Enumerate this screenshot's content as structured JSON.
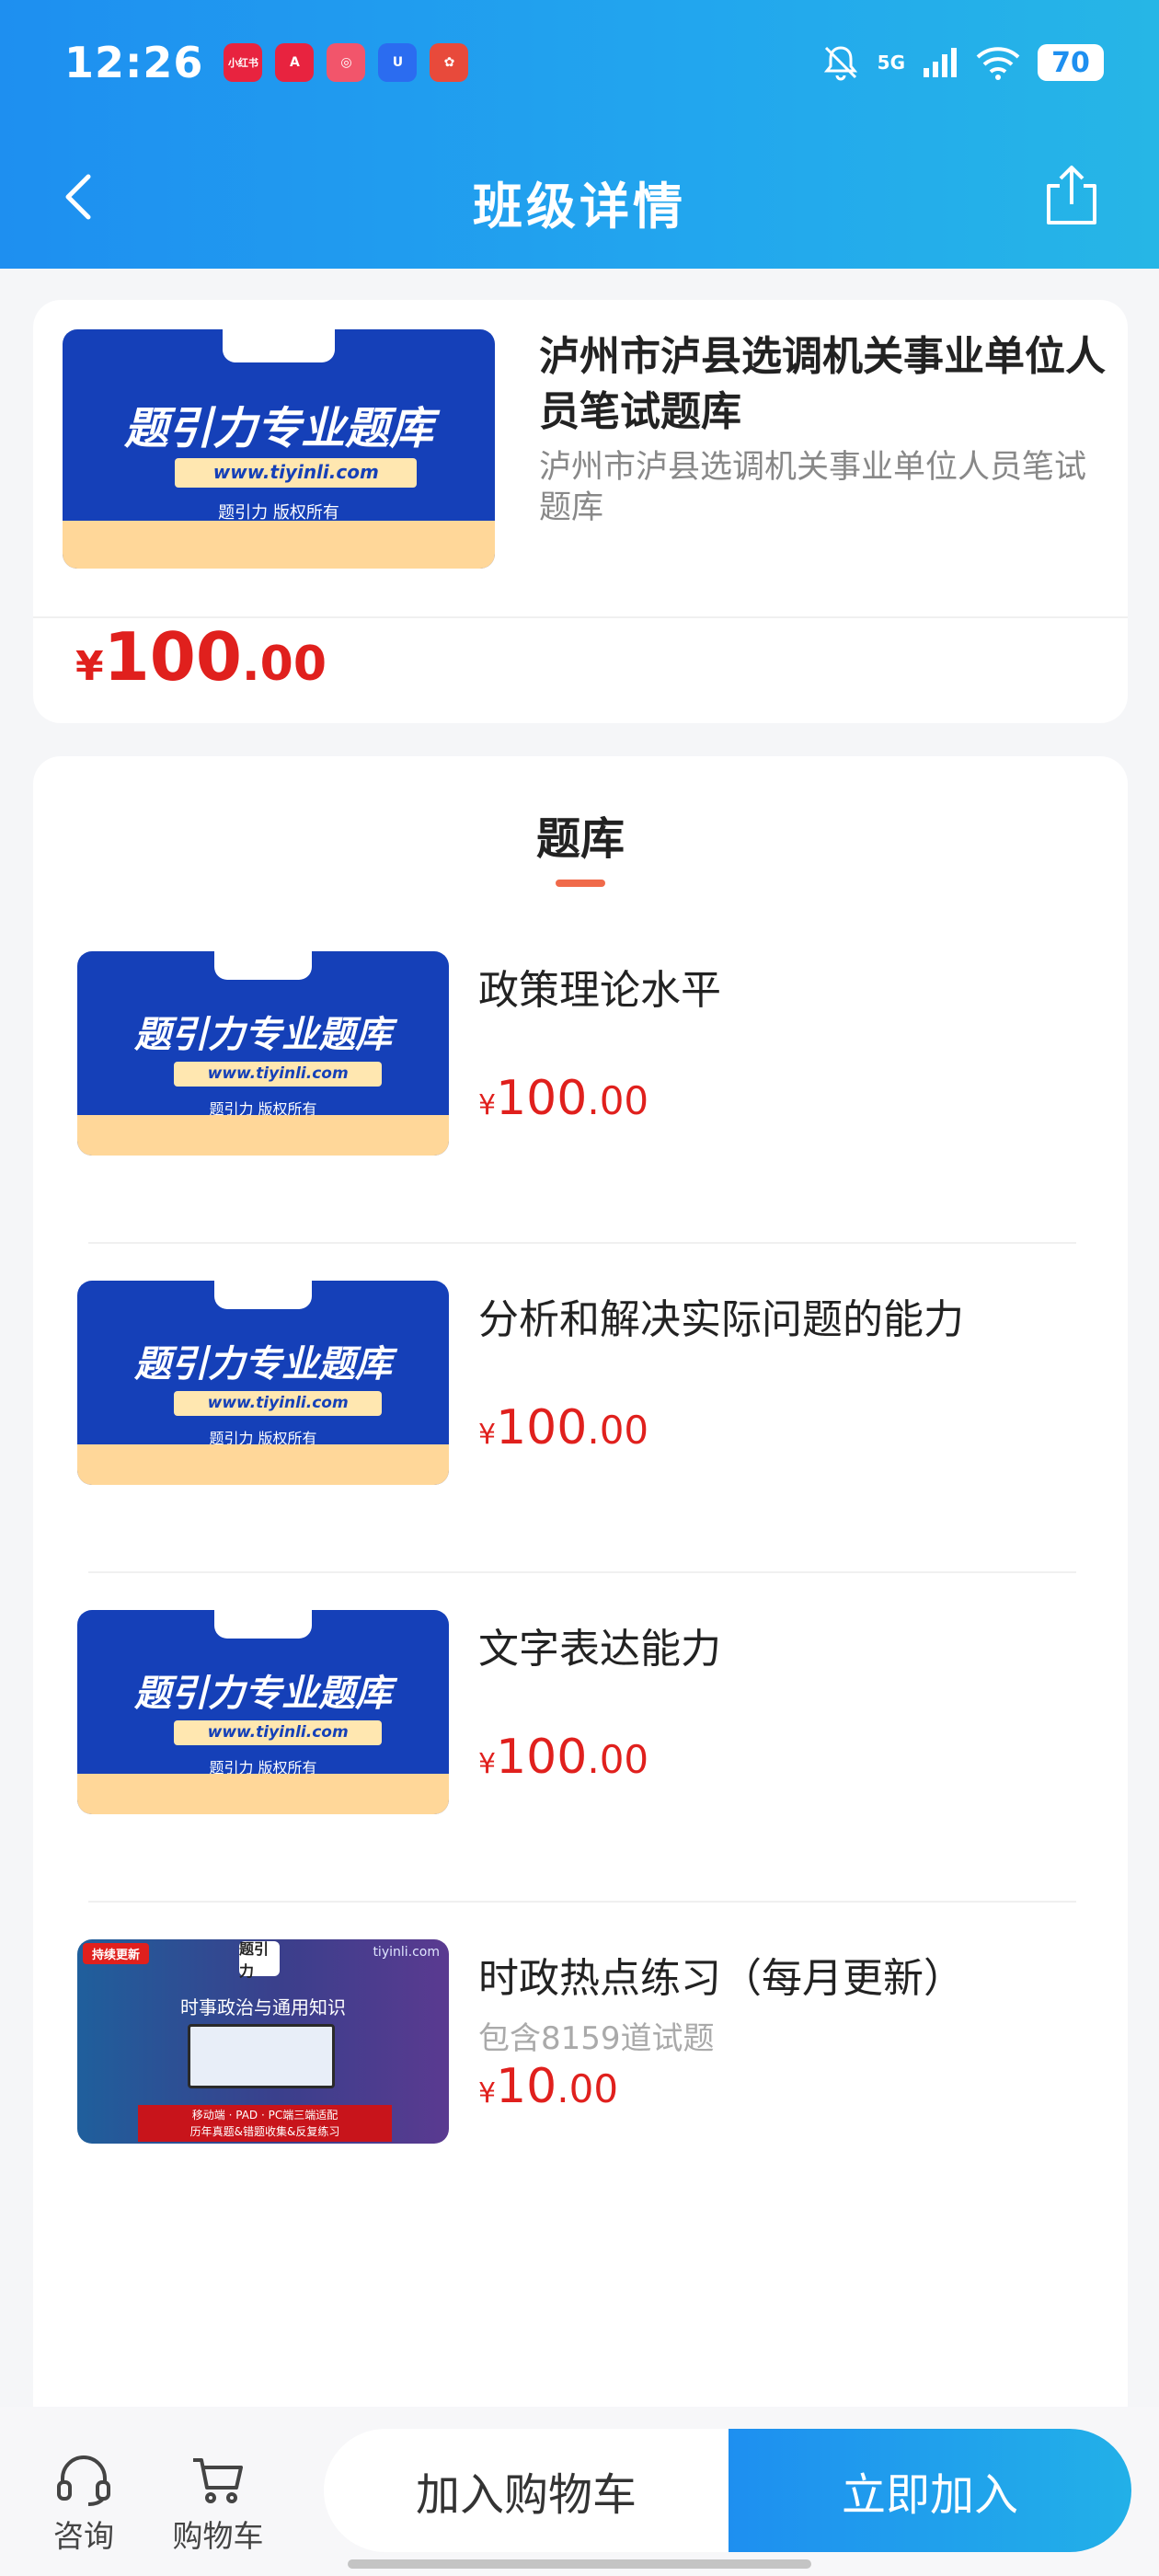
{
  "status_bar": {
    "time": "12:26",
    "app_icons": [
      {
        "name": "xiaohongshu-icon",
        "label": "小红书",
        "color": "#e8233f"
      },
      {
        "name": "app-a-icon",
        "label": "A",
        "color": "#e8233f"
      },
      {
        "name": "app-pink-icon",
        "label": "◎",
        "color": "#f2556b"
      },
      {
        "name": "app-u-icon",
        "label": "U",
        "color": "#2b6cf0"
      },
      {
        "name": "app-heart-icon",
        "label": "✿",
        "color": "#e84a3b"
      }
    ],
    "network": "5G",
    "battery": "70"
  },
  "nav": {
    "title": "班级详情"
  },
  "class_card": {
    "title": "泸州市泸县选调机关事业单位人员笔试题库",
    "subtitle": "泸州市泸县选调机关事业单位人员笔试题库",
    "price": {
      "currency": "¥",
      "int": "100",
      "dec": ".00"
    },
    "cover": {
      "headline": "题引力专业题库",
      "url": "www.tiyinli.com",
      "copyright": "题引力 版权所有",
      "brand": "题引力"
    }
  },
  "bank_section": {
    "title": "题库",
    "items": [
      {
        "name": "政策理论水平",
        "count": "",
        "price": {
          "currency": "¥",
          "int": "100",
          "dec": ".00"
        },
        "cover_type": "blue"
      },
      {
        "name": "分析和解决实际问题的能力",
        "count": "",
        "price": {
          "currency": "¥",
          "int": "100",
          "dec": ".00"
        },
        "cover_type": "blue"
      },
      {
        "name": "文字表达能力",
        "count": "",
        "price": {
          "currency": "¥",
          "int": "100",
          "dec": ".00"
        },
        "cover_type": "blue"
      },
      {
        "name": "时政热点练习（每月更新）",
        "count": "包含8159道试题",
        "price": {
          "currency": "¥",
          "int": "10",
          "dec": ".00"
        },
        "cover_type": "purple"
      }
    ],
    "purple_cover": {
      "badge": "持续更新",
      "site": "tiyinli.com",
      "title": "时事政治与通用知识",
      "bar_line1": "移动端 · PAD · PC端三端适配",
      "bar_line2": "历年真题&错题收集&反复练习",
      "logo": "题引力"
    }
  },
  "bottom_bar": {
    "consult_label": "咨询",
    "cart_label": "购物车",
    "add_cart_button": "加入购物车",
    "join_button": "立即加入"
  },
  "colors": {
    "accent_blue": "#1e8ff0",
    "price_red": "#e0201d",
    "underline_orange": "#f06a4a"
  }
}
